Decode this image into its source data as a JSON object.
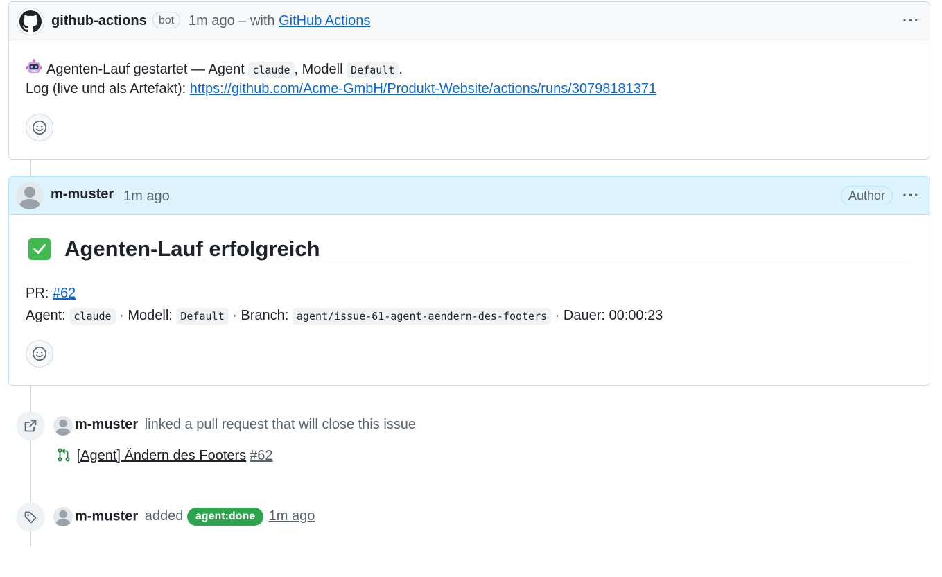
{
  "bot_comment": {
    "author": "github-actions",
    "badge": "bot",
    "time": "1m ago",
    "via_prefix": "– with",
    "via_link": "GitHub Actions",
    "line1_text": "Agenten-Lauf gestartet — Agent",
    "agent_code": "claude",
    "model_prefix": ", Modell",
    "model_code": "Default",
    "line1_end": ".",
    "log_prefix": "Log (live und als Artefakt):",
    "log_url": "https://github.com/Acme-GmbH/Produkt-Website/actions/runs/30798181371"
  },
  "author_comment": {
    "author": "m-muster",
    "time": "1m ago",
    "author_badge": "Author",
    "heading": "Agenten-Lauf erfolgreich",
    "pr_label": "PR:",
    "pr_link": "#62",
    "agent_label": "Agent:",
    "agent_code": "claude",
    "model_label": "· Modell:",
    "model_code": "Default",
    "branch_label": "· Branch:",
    "branch_code": "agent/issue-61-agent-aendern-des-footers",
    "duration": "· Dauer: 00:00:23"
  },
  "events": [
    {
      "user": "m-muster",
      "action": "linked a pull request that will close this issue",
      "pr_title": "[Agent] Ändern des Footers",
      "pr_number": "#62"
    },
    {
      "user": "m-muster",
      "action": "added",
      "label": "agent:done",
      "time": "1m ago"
    }
  ],
  "colors": {
    "link": "#0969da",
    "label_bg": "#2da44e",
    "author_header_bg": "#ddf4ff",
    "check_green": "#3fb950"
  }
}
